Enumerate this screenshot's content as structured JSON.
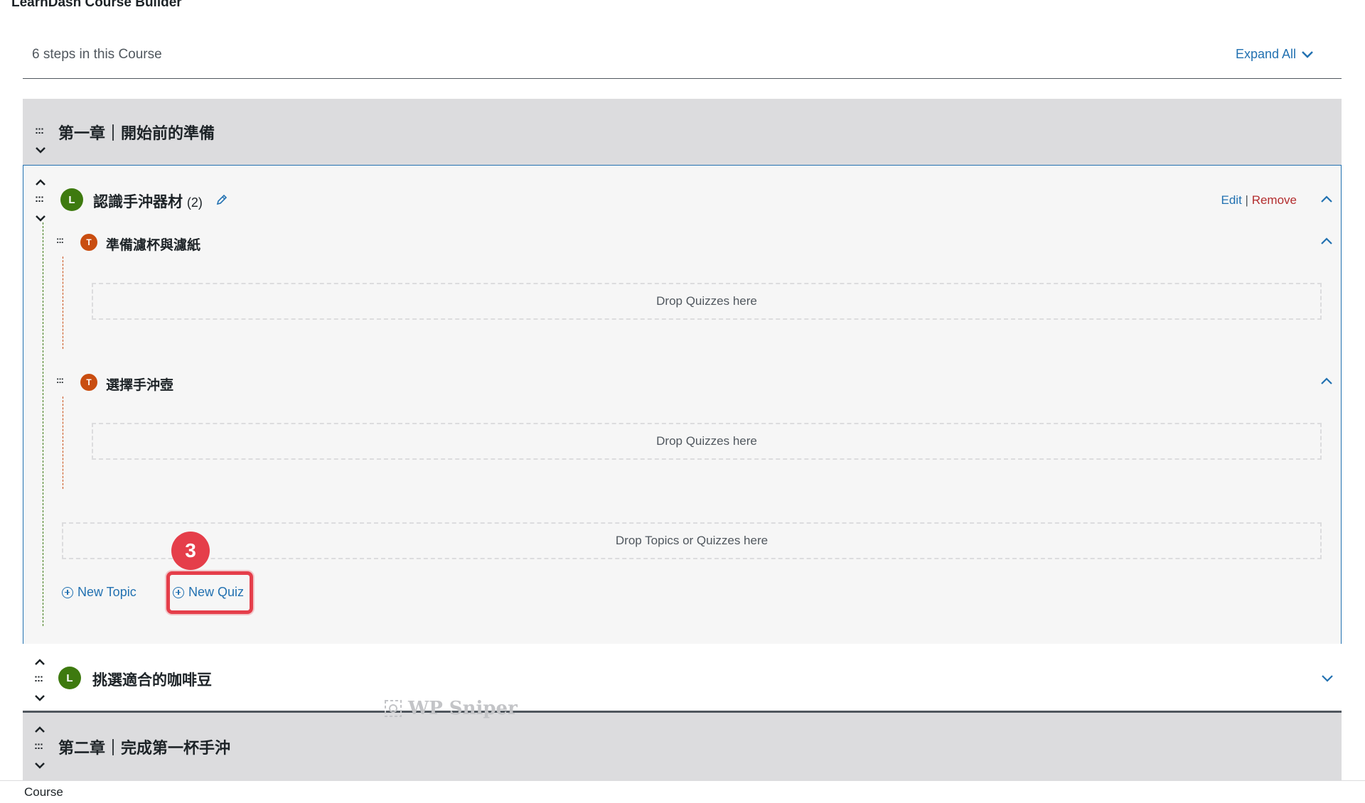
{
  "page": {
    "title": "LearnDash Course Builder"
  },
  "header": {
    "steps_text": "6 steps in this Course",
    "expand_all_label": "Expand All"
  },
  "sections": [
    {
      "title": "第一章｜開始前的準備"
    },
    {
      "title": "第二章｜完成第一杯手沖"
    }
  ],
  "lessons": [
    {
      "badge": "L",
      "title": "認識手沖器材",
      "count": "(2)",
      "actions": {
        "edit": "Edit",
        "separator": "|",
        "remove": "Remove"
      },
      "topics": [
        {
          "badge": "T",
          "title": "準備濾杯與濾紙",
          "dropzone": "Drop Quizzes here"
        },
        {
          "badge": "T",
          "title": "選擇手沖壺",
          "dropzone": "Drop Quizzes here"
        }
      ],
      "dropzone": "Drop Topics or Quizzes here",
      "new_topic_label": "New Topic",
      "new_quiz_label": "New Quiz"
    },
    {
      "badge": "L",
      "title": "挑選適合的咖啡豆"
    }
  ],
  "annotation": {
    "step_number": "3",
    "color": "#e53e4a"
  },
  "watermark": {
    "text": "WP Sniper"
  },
  "footer": {
    "tab_label": "Course"
  },
  "colors": {
    "link": "#2271b1",
    "remove": "#b32d2e",
    "lesson_badge": "#3e7a0f",
    "topic_badge": "#c94d10",
    "section_bg": "#dcdcde"
  },
  "icons": [
    "drag-handle-icon",
    "chevron-up-icon",
    "chevron-down-icon",
    "pencil-icon",
    "plus-circle-icon",
    "wp-sniper-logo"
  ]
}
